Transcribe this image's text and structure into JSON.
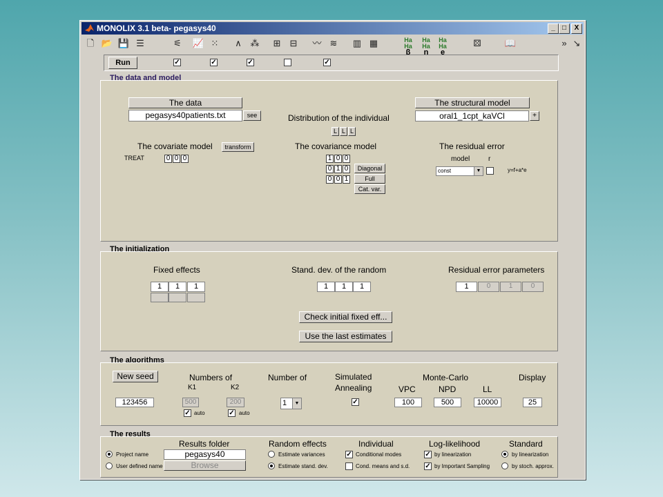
{
  "window": {
    "title": "MONOLIX 3.1 beta- pegasys40",
    "min": "_",
    "max": "□",
    "close": "X"
  },
  "toolbar": {
    "overflow": "»",
    "extra": "↘",
    "tools": [
      "new-file",
      "open-folder",
      "save",
      "properties",
      "settings-a",
      "settings-b",
      "plot-a",
      "plot-b",
      "curve-a",
      "curve-b",
      "tree-a",
      "tree-b",
      "wave-a",
      "wave-b",
      "bars-a",
      "bars-b",
      "param-beta",
      "param-eta",
      "param-e",
      "dice",
      "book"
    ],
    "greek": [
      "β",
      "η",
      "e"
    ],
    "greek_top": "Ha Ha"
  },
  "run": {
    "label": "Run",
    "checks": [
      true,
      true,
      true,
      false,
      true
    ]
  },
  "data_model": {
    "title": "The data and model",
    "data_btn": "The data",
    "data_file": "pegasys40patients.txt",
    "see_btn": "see",
    "distribution_label": "Distribution of the individual",
    "dist_btns": [
      "L",
      "L",
      "L"
    ],
    "structural_btn": "The structural model",
    "structural_file": "oral1_1cpt_kaVCl",
    "plus_btn": "+",
    "covariate_label": "The covariate model",
    "transform_btn": "transform",
    "treat_label": "TREAT",
    "treat_cells": [
      "0",
      "0",
      "0"
    ],
    "covariance_label": "The covariance model",
    "cov_matrix": [
      [
        "1",
        "0",
        "0"
      ],
      [
        "0",
        "1",
        "0"
      ],
      [
        "0",
        "0",
        "1"
      ]
    ],
    "diag_btn": "Diagonal",
    "full_btn": "Full",
    "catvar_btn": "Cat. var.",
    "residual_label": "The residual error",
    "model_label": "model",
    "r_label": "r",
    "model_value": "const",
    "formula": "y=f+a*e"
  },
  "init": {
    "title": "The initialization",
    "fixed_label": "Fixed effects",
    "fixed_vals": [
      "1",
      "1",
      "1"
    ],
    "std_label": "Stand. dev. of the random",
    "std_vals": [
      "1",
      "1",
      "1"
    ],
    "resid_label": "Residual error parameters",
    "resid_vals": [
      "1",
      "0",
      "1",
      "0"
    ],
    "check_btn": "Check initial fixed eff...",
    "last_btn": "Use the last estimates"
  },
  "algo": {
    "title": "The algorithms",
    "seed_btn": "New seed",
    "seed_val": "123456",
    "numbers_of": "Numbers of",
    "k1_label": "K1",
    "k2_label": "K2",
    "k1_val": "500",
    "k2_val": "200",
    "auto_label": "auto",
    "number_of": "Number of",
    "number_val": "1",
    "simulated": "Simulated",
    "annealing": "Annealing",
    "montecarlo": "Monte-Carlo",
    "vpc_label": "VPC",
    "npd_label": "NPD",
    "ll_label": "LL",
    "vpc_val": "100",
    "npd_val": "500",
    "ll_val": "10000",
    "display_label": "Display",
    "display_val": "25"
  },
  "results": {
    "title": "The results",
    "folder_label": "Results folder",
    "folder_val": "pegasys40",
    "project_name": "Project name",
    "user_defined": "User defined name",
    "browse_btn": "Browse",
    "random_label": "Random effects",
    "est_var": "Estimate variances",
    "est_std": "Estimate stand. dev.",
    "individual_label": "Individual",
    "cond_modes": "Conditional modes",
    "cond_means": "Cond. means and s.d.",
    "loglik_label": "Log-likelihood",
    "by_lin": "by linearization",
    "by_is": "by Important Sampling",
    "standard_label": "Standard",
    "std_lin": "by linearization",
    "std_stoch": "by stoch. approx."
  }
}
